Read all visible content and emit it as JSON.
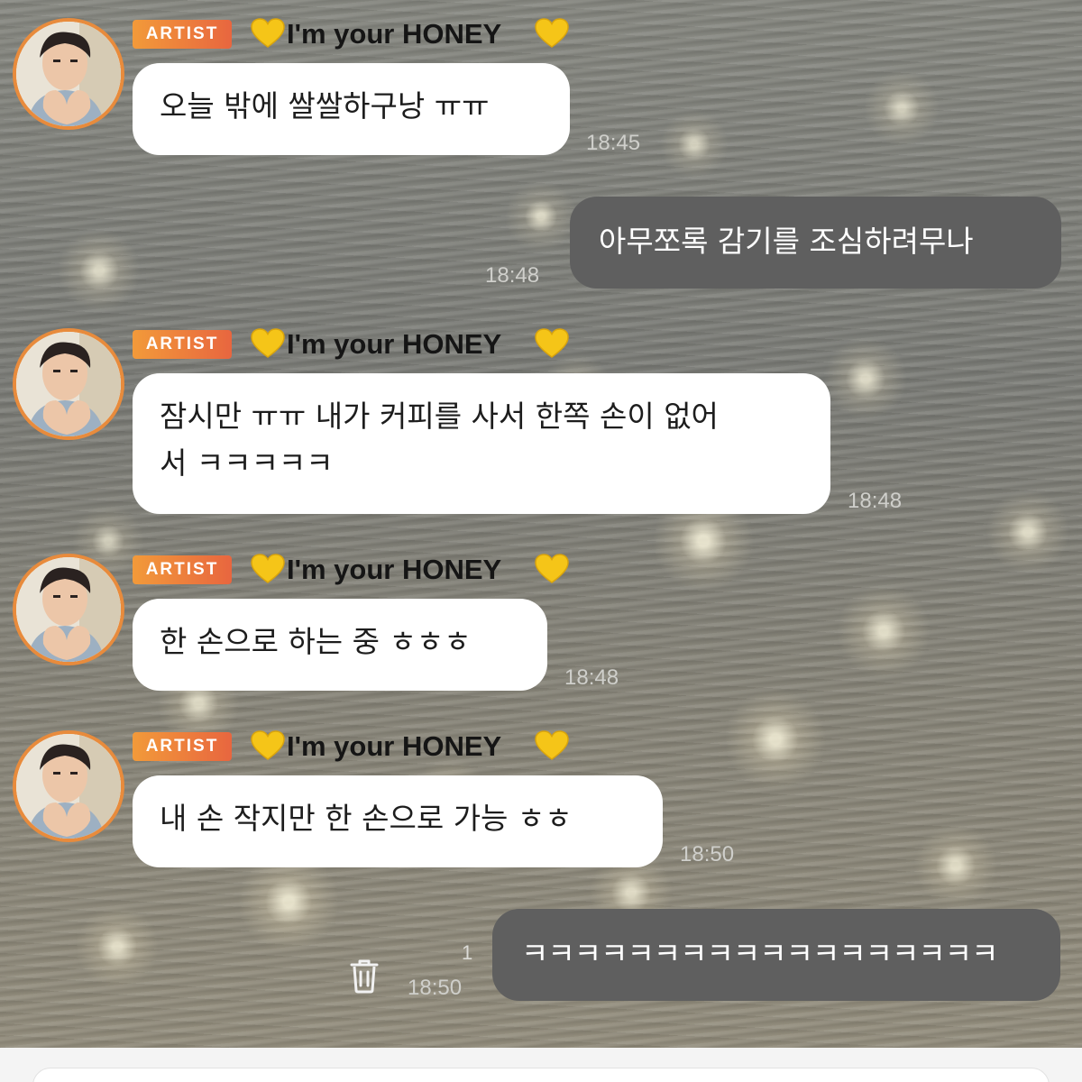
{
  "chat": {
    "artist_badge": "ARTIST",
    "sender_name": "I'm your HONEY",
    "heart_icon": "yellow-heart-icon",
    "avatar_icon": "artist-profile-photo",
    "messages": [
      {
        "direction": "incoming",
        "show_header": true,
        "text": "오늘 밖에 쌀쌀하구낭 ㅠㅠ",
        "time": "18:45"
      },
      {
        "direction": "outgoing",
        "show_header": false,
        "text": "아무쪼록 감기를 조심하려무나",
        "time": "18:48"
      },
      {
        "direction": "incoming",
        "show_header": true,
        "text": "잠시만 ㅠㅠ 내가 커피를 사서 한쪽 손이 없어\n서 ㅋㅋㅋㅋㅋ",
        "time": "18:48"
      },
      {
        "direction": "incoming",
        "show_header": true,
        "text": "한 손으로 하는 중 ㅎㅎㅎ",
        "time": "18:48"
      },
      {
        "direction": "incoming",
        "show_header": true,
        "text": "내 손 작지만 한 손으로 가능 ㅎㅎ",
        "time": "18:50"
      },
      {
        "direction": "outgoing",
        "show_header": false,
        "text": "ㅋㅋㅋㅋㅋㅋㅋㅋㅋㅋㅋㅋㅋㅋㅋㅋㅋㅋ",
        "time": "18:50",
        "unread_count": "1",
        "action_icon": "trash-icon"
      }
    ]
  },
  "composer": {
    "placeholder": ""
  },
  "colors": {
    "artist_badge": "#ec7a3c",
    "avatar_ring": "#e88b3c",
    "incoming_bubble": "#ffffff",
    "outgoing_bubble": "#5f5f5f",
    "heart": "#f5c518"
  }
}
